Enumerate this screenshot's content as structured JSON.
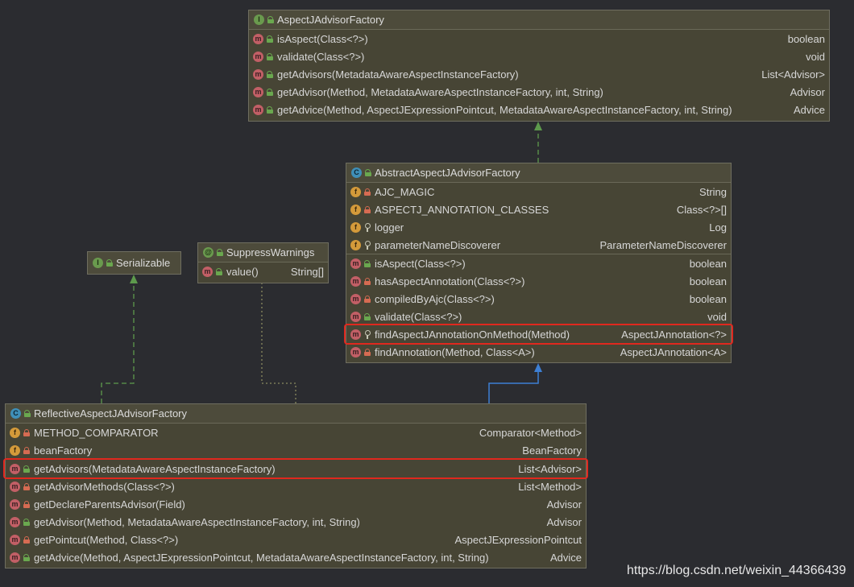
{
  "diagram": {
    "nodes": [
      {
        "id": "aspectj-advisor-factory",
        "badge": "I",
        "kind": "interface",
        "title": "AspectJAdvisorFactory",
        "sections": [
          [
            {
              "icon": "m",
              "vis": "pub",
              "name": "isAspect(Class<?>)",
              "type": "boolean"
            },
            {
              "icon": "m",
              "vis": "pub",
              "name": "validate(Class<?>)",
              "type": "void"
            },
            {
              "icon": "m",
              "vis": "pub",
              "name": "getAdvisors(MetadataAwareAspectInstanceFactory)",
              "type": "List<Advisor>"
            },
            {
              "icon": "m",
              "vis": "pub",
              "name": "getAdvisor(Method, MetadataAwareAspectInstanceFactory, int, String)",
              "type": "Advisor"
            },
            {
              "icon": "m",
              "vis": "pub",
              "name": "getAdvice(Method, AspectJExpressionPointcut, MetadataAwareAspectInstanceFactory, int, String)",
              "type": "Advice"
            }
          ]
        ]
      },
      {
        "id": "abstract-aspectj-advisor-factory",
        "badge": "C",
        "kind": "abstract-class",
        "title": "AbstractAspectJAdvisorFactory",
        "sections": [
          [
            {
              "icon": "f",
              "vis": "priv",
              "name": "AJC_MAGIC",
              "type": "String"
            },
            {
              "icon": "f",
              "vis": "priv",
              "name": "ASPECTJ_ANNOTATION_CLASSES",
              "type": "Class<?>[]"
            },
            {
              "icon": "f",
              "vis": "prot",
              "name": "logger",
              "type": "Log"
            },
            {
              "icon": "f",
              "vis": "prot",
              "name": "parameterNameDiscoverer",
              "type": "ParameterNameDiscoverer"
            }
          ],
          [
            {
              "icon": "m",
              "vis": "pub",
              "name": "isAspect(Class<?>)",
              "type": "boolean"
            },
            {
              "icon": "m",
              "vis": "priv",
              "name": "hasAspectAnnotation(Class<?>)",
              "type": "boolean"
            },
            {
              "icon": "m",
              "vis": "priv",
              "name": "compiledByAjc(Class<?>)",
              "type": "boolean"
            },
            {
              "icon": "m",
              "vis": "pub",
              "name": "validate(Class<?>)",
              "type": "void"
            },
            {
              "icon": "m",
              "vis": "prot",
              "name": "findAspectJAnnotationOnMethod(Method)",
              "type": "AspectJAnnotation<?>",
              "highlight": true
            },
            {
              "icon": "m",
              "vis": "priv",
              "name": "findAnnotation(Method, Class<A>)",
              "type": "AspectJAnnotation<A>"
            }
          ]
        ]
      },
      {
        "id": "serializable",
        "badge": "I",
        "kind": "interface",
        "title": "Serializable",
        "sections": []
      },
      {
        "id": "suppress-warnings",
        "badge": "@",
        "kind": "annotation",
        "title": "SuppressWarnings",
        "sections": [
          [
            {
              "icon": "m",
              "vis": "pub",
              "name": "value()",
              "type": "String[]"
            }
          ]
        ]
      },
      {
        "id": "reflective-aspectj-advisor-factory",
        "badge": "C",
        "kind": "class",
        "title": "ReflectiveAspectJAdvisorFactory",
        "sections": [
          [
            {
              "icon": "f",
              "vis": "priv",
              "name": "METHOD_COMPARATOR",
              "type": "Comparator<Method>"
            },
            {
              "icon": "f",
              "vis": "priv",
              "name": "beanFactory",
              "type": "BeanFactory"
            }
          ],
          [
            {
              "icon": "m",
              "vis": "pub",
              "name": "getAdvisors(MetadataAwareAspectInstanceFactory)",
              "type": "List<Advisor>",
              "highlight": true
            },
            {
              "icon": "m",
              "vis": "priv",
              "name": "getAdvisorMethods(Class<?>)",
              "type": "List<Method>"
            },
            {
              "icon": "m",
              "vis": "priv",
              "name": "getDeclareParentsAdvisor(Field)",
              "type": "Advisor"
            },
            {
              "icon": "m",
              "vis": "pub",
              "name": "getAdvisor(Method, MetadataAwareAspectInstanceFactory, int, String)",
              "type": "Advisor"
            },
            {
              "icon": "m",
              "vis": "priv",
              "name": "getPointcut(Method, Class<?>)",
              "type": "AspectJExpressionPointcut"
            },
            {
              "icon": "m",
              "vis": "pub",
              "name": "getAdvice(Method, AspectJExpressionPointcut, MetadataAwareAspectInstanceFactory, int, String)",
              "type": "Advice"
            }
          ]
        ]
      }
    ],
    "edges": [
      {
        "from": "abstract-aspectj-advisor-factory",
        "to": "aspectj-advisor-factory",
        "kind": "implements"
      },
      {
        "from": "reflective-aspectj-advisor-factory",
        "to": "abstract-aspectj-advisor-factory",
        "kind": "extends"
      },
      {
        "from": "reflective-aspectj-advisor-factory",
        "to": "serializable",
        "kind": "implements"
      },
      {
        "from": "reflective-aspectj-advisor-factory",
        "to": "suppress-warnings",
        "kind": "annotated-by"
      }
    ],
    "colors": {
      "background": "#2b2c30",
      "node_fill": "#474535",
      "implements_edge": "#5d9a4c",
      "extends_edge": "#3d7fd4",
      "highlight": "#e0281e"
    }
  },
  "watermark": "https://blog.csdn.net/weixin_44366439"
}
